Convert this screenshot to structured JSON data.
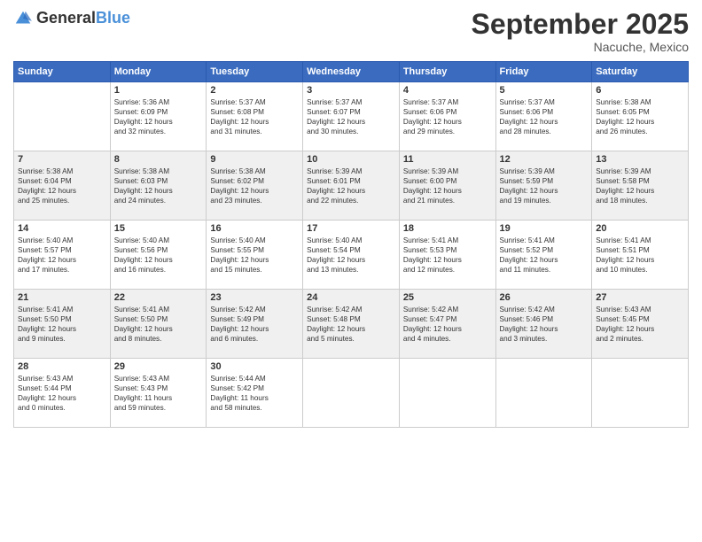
{
  "logo": {
    "general": "General",
    "blue": "Blue"
  },
  "title": "September 2025",
  "location": "Nacuche, Mexico",
  "days_header": [
    "Sunday",
    "Monday",
    "Tuesday",
    "Wednesday",
    "Thursday",
    "Friday",
    "Saturday"
  ],
  "weeks": [
    [
      {
        "day": "",
        "info": ""
      },
      {
        "day": "1",
        "info": "Sunrise: 5:36 AM\nSunset: 6:09 PM\nDaylight: 12 hours\nand 32 minutes."
      },
      {
        "day": "2",
        "info": "Sunrise: 5:37 AM\nSunset: 6:08 PM\nDaylight: 12 hours\nand 31 minutes."
      },
      {
        "day": "3",
        "info": "Sunrise: 5:37 AM\nSunset: 6:07 PM\nDaylight: 12 hours\nand 30 minutes."
      },
      {
        "day": "4",
        "info": "Sunrise: 5:37 AM\nSunset: 6:06 PM\nDaylight: 12 hours\nand 29 minutes."
      },
      {
        "day": "5",
        "info": "Sunrise: 5:37 AM\nSunset: 6:06 PM\nDaylight: 12 hours\nand 28 minutes."
      },
      {
        "day": "6",
        "info": "Sunrise: 5:38 AM\nSunset: 6:05 PM\nDaylight: 12 hours\nand 26 minutes."
      }
    ],
    [
      {
        "day": "7",
        "info": "Sunrise: 5:38 AM\nSunset: 6:04 PM\nDaylight: 12 hours\nand 25 minutes."
      },
      {
        "day": "8",
        "info": "Sunrise: 5:38 AM\nSunset: 6:03 PM\nDaylight: 12 hours\nand 24 minutes."
      },
      {
        "day": "9",
        "info": "Sunrise: 5:38 AM\nSunset: 6:02 PM\nDaylight: 12 hours\nand 23 minutes."
      },
      {
        "day": "10",
        "info": "Sunrise: 5:39 AM\nSunset: 6:01 PM\nDaylight: 12 hours\nand 22 minutes."
      },
      {
        "day": "11",
        "info": "Sunrise: 5:39 AM\nSunset: 6:00 PM\nDaylight: 12 hours\nand 21 minutes."
      },
      {
        "day": "12",
        "info": "Sunrise: 5:39 AM\nSunset: 5:59 PM\nDaylight: 12 hours\nand 19 minutes."
      },
      {
        "day": "13",
        "info": "Sunrise: 5:39 AM\nSunset: 5:58 PM\nDaylight: 12 hours\nand 18 minutes."
      }
    ],
    [
      {
        "day": "14",
        "info": "Sunrise: 5:40 AM\nSunset: 5:57 PM\nDaylight: 12 hours\nand 17 minutes."
      },
      {
        "day": "15",
        "info": "Sunrise: 5:40 AM\nSunset: 5:56 PM\nDaylight: 12 hours\nand 16 minutes."
      },
      {
        "day": "16",
        "info": "Sunrise: 5:40 AM\nSunset: 5:55 PM\nDaylight: 12 hours\nand 15 minutes."
      },
      {
        "day": "17",
        "info": "Sunrise: 5:40 AM\nSunset: 5:54 PM\nDaylight: 12 hours\nand 13 minutes."
      },
      {
        "day": "18",
        "info": "Sunrise: 5:41 AM\nSunset: 5:53 PM\nDaylight: 12 hours\nand 12 minutes."
      },
      {
        "day": "19",
        "info": "Sunrise: 5:41 AM\nSunset: 5:52 PM\nDaylight: 12 hours\nand 11 minutes."
      },
      {
        "day": "20",
        "info": "Sunrise: 5:41 AM\nSunset: 5:51 PM\nDaylight: 12 hours\nand 10 minutes."
      }
    ],
    [
      {
        "day": "21",
        "info": "Sunrise: 5:41 AM\nSunset: 5:50 PM\nDaylight: 12 hours\nand 9 minutes."
      },
      {
        "day": "22",
        "info": "Sunrise: 5:41 AM\nSunset: 5:50 PM\nDaylight: 12 hours\nand 8 minutes."
      },
      {
        "day": "23",
        "info": "Sunrise: 5:42 AM\nSunset: 5:49 PM\nDaylight: 12 hours\nand 6 minutes."
      },
      {
        "day": "24",
        "info": "Sunrise: 5:42 AM\nSunset: 5:48 PM\nDaylight: 12 hours\nand 5 minutes."
      },
      {
        "day": "25",
        "info": "Sunrise: 5:42 AM\nSunset: 5:47 PM\nDaylight: 12 hours\nand 4 minutes."
      },
      {
        "day": "26",
        "info": "Sunrise: 5:42 AM\nSunset: 5:46 PM\nDaylight: 12 hours\nand 3 minutes."
      },
      {
        "day": "27",
        "info": "Sunrise: 5:43 AM\nSunset: 5:45 PM\nDaylight: 12 hours\nand 2 minutes."
      }
    ],
    [
      {
        "day": "28",
        "info": "Sunrise: 5:43 AM\nSunset: 5:44 PM\nDaylight: 12 hours\nand 0 minutes."
      },
      {
        "day": "29",
        "info": "Sunrise: 5:43 AM\nSunset: 5:43 PM\nDaylight: 11 hours\nand 59 minutes."
      },
      {
        "day": "30",
        "info": "Sunrise: 5:44 AM\nSunset: 5:42 PM\nDaylight: 11 hours\nand 58 minutes."
      },
      {
        "day": "",
        "info": ""
      },
      {
        "day": "",
        "info": ""
      },
      {
        "day": "",
        "info": ""
      },
      {
        "day": "",
        "info": ""
      }
    ]
  ]
}
